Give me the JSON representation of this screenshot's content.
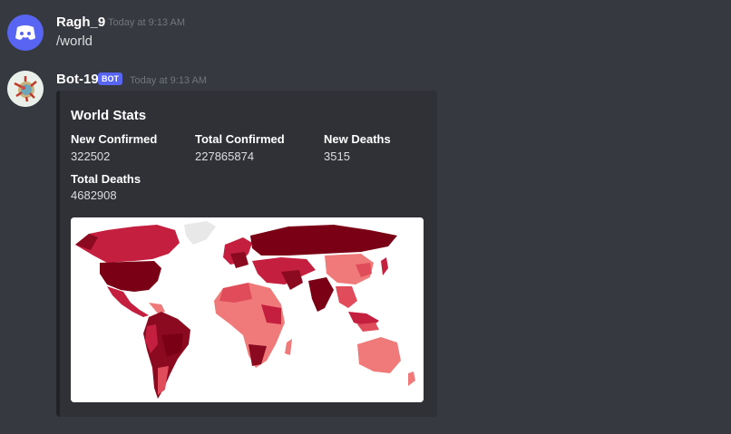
{
  "messages": [
    {
      "username": "Ragh_9",
      "timestamp": "Today at 9:13 AM",
      "content": "/world"
    },
    {
      "username": "Bot-19",
      "badge": "BOT",
      "timestamp": "Today at 9:13 AM"
    }
  ],
  "embed": {
    "title": "World Stats",
    "fields": [
      {
        "name": "New Confirmed",
        "value": "322502"
      },
      {
        "name": "Total Confirmed",
        "value": "227865874"
      },
      {
        "name": "New Deaths",
        "value": "3515"
      },
      {
        "name": "Total Deaths",
        "value": "4682908"
      }
    ],
    "map_icon": "world-choropleth-map"
  },
  "colors": {
    "background": "#36393f",
    "embed_background": "#2f3136",
    "bot_badge": "#5865f2",
    "discord_avatar": "#5865f2",
    "map_dark": "#7a0016",
    "map_mid": "#c41f3e",
    "map_light": "#f07a7a"
  }
}
